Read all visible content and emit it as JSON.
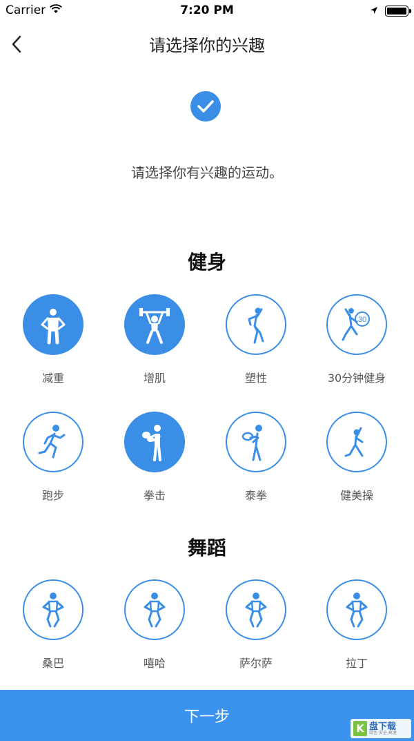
{
  "status_bar": {
    "carrier": "Carrier",
    "time": "7:20 PM"
  },
  "nav": {
    "title": "请选择你的兴趣"
  },
  "instruction": "请选择你有兴趣的运动。",
  "sections": [
    {
      "title": "健身",
      "items": [
        {
          "label": "减重",
          "icon": "standing-hands-on-hips-icon",
          "selected": true
        },
        {
          "label": "增肌",
          "icon": "weightlifter-icon",
          "selected": true
        },
        {
          "label": "塑性",
          "icon": "shaping-pose-icon",
          "selected": false
        },
        {
          "label": "30分钟健身",
          "icon": "thirty-minute-workout-icon",
          "selected": false
        },
        {
          "label": "跑步",
          "icon": "runner-icon",
          "selected": false
        },
        {
          "label": "拳击",
          "icon": "boxer-icon",
          "selected": true
        },
        {
          "label": "泰拳",
          "icon": "muay-thai-icon",
          "selected": false
        },
        {
          "label": "健美操",
          "icon": "aerobics-icon",
          "selected": false
        }
      ]
    },
    {
      "title": "舞蹈",
      "items": [
        {
          "label": "桑巴",
          "icon": "dancer-icon",
          "selected": false
        },
        {
          "label": "嘻哈",
          "icon": "dancer-icon",
          "selected": false
        },
        {
          "label": "萨尔萨",
          "icon": "dancer-icon",
          "selected": false
        },
        {
          "label": "拉丁",
          "icon": "dancer-icon",
          "selected": false
        }
      ]
    }
  ],
  "icon_badge_text": "30",
  "next_button": "下一步",
  "watermark": {
    "name": "盘下载",
    "sub": "绿色·安全·高速",
    "mark": "K"
  },
  "colors": {
    "accent": "#3a8ee6",
    "button": "#3a93ee"
  }
}
